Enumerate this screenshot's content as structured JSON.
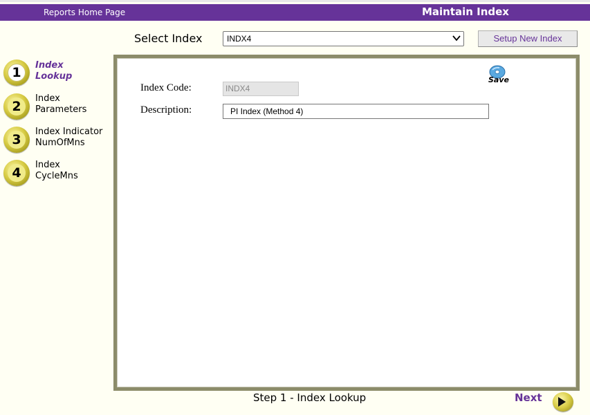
{
  "header": {
    "home_link": "Reports Home Page",
    "title": "Maintain Index"
  },
  "toolbar": {
    "select_label": "Select Index",
    "selected_index": "INDX4",
    "setup_button": "Setup New Index"
  },
  "steps": [
    {
      "number": "1",
      "line1": "Index",
      "line2": "Lookup",
      "active": true
    },
    {
      "number": "2",
      "line1": "Index",
      "line2": "Parameters",
      "active": false
    },
    {
      "number": "3",
      "line1": "Index Indicator",
      "line2": "NumOfMns",
      "active": false
    },
    {
      "number": "4",
      "line1": "Index",
      "line2": "CycleMns",
      "active": false
    }
  ],
  "form": {
    "save_label": "Save",
    "index_code_label": "Index Code:",
    "index_code_value": "INDX4",
    "description_label": "Description:",
    "description_value": "PI Index (Method 4)"
  },
  "footer": {
    "step_text": "Step 1 - Index Lookup",
    "next_label": "Next"
  },
  "colors": {
    "brand": "#663399",
    "panel_frame": "#8c8c6a",
    "page_background": "#fffff3"
  }
}
